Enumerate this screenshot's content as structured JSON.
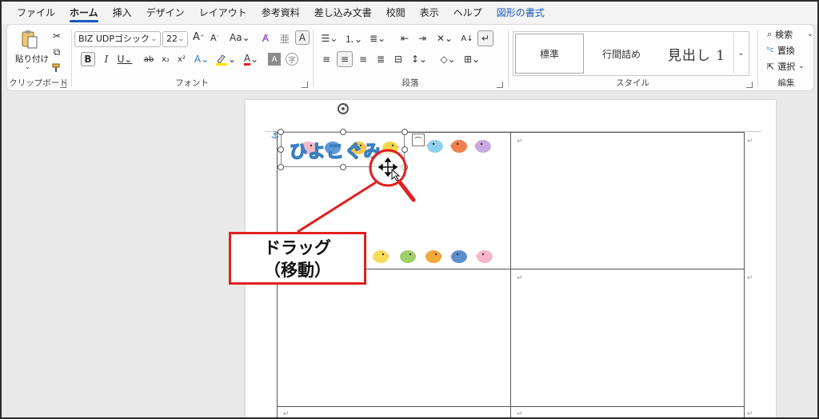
{
  "menu": {
    "tabs": [
      "ファイル",
      "ホーム",
      "挿入",
      "デザイン",
      "レイアウト",
      "参考資料",
      "差し込み文書",
      "校閲",
      "表示",
      "ヘルプ",
      "図形の書式"
    ],
    "active_tab": "ホーム",
    "context_tab": "図形の書式"
  },
  "ribbon": {
    "clipboard": {
      "label": "クリップボード",
      "paste_label": "貼り付け"
    },
    "font": {
      "label": "フォント",
      "font_name": "BIZ UDPゴシック",
      "font_size": "22",
      "size_up": "A",
      "size_down": "A",
      "case": "Aa"
    },
    "paragraph": {
      "label": "段落"
    },
    "styles": {
      "label": "スタイル",
      "items": [
        "標準",
        "行間詰め",
        "見出し 1"
      ]
    },
    "editing": {
      "label": "編集",
      "find": "検索",
      "replace": "置換",
      "select": "選択"
    }
  },
  "document": {
    "title_text": "ひよこぐみ",
    "callout_line1": "ドラッグ",
    "callout_line2": "（移動）"
  },
  "colors": {
    "accent": "#185abd",
    "callout_border": "#e0201f",
    "title_outline": "#3a7fc0"
  }
}
